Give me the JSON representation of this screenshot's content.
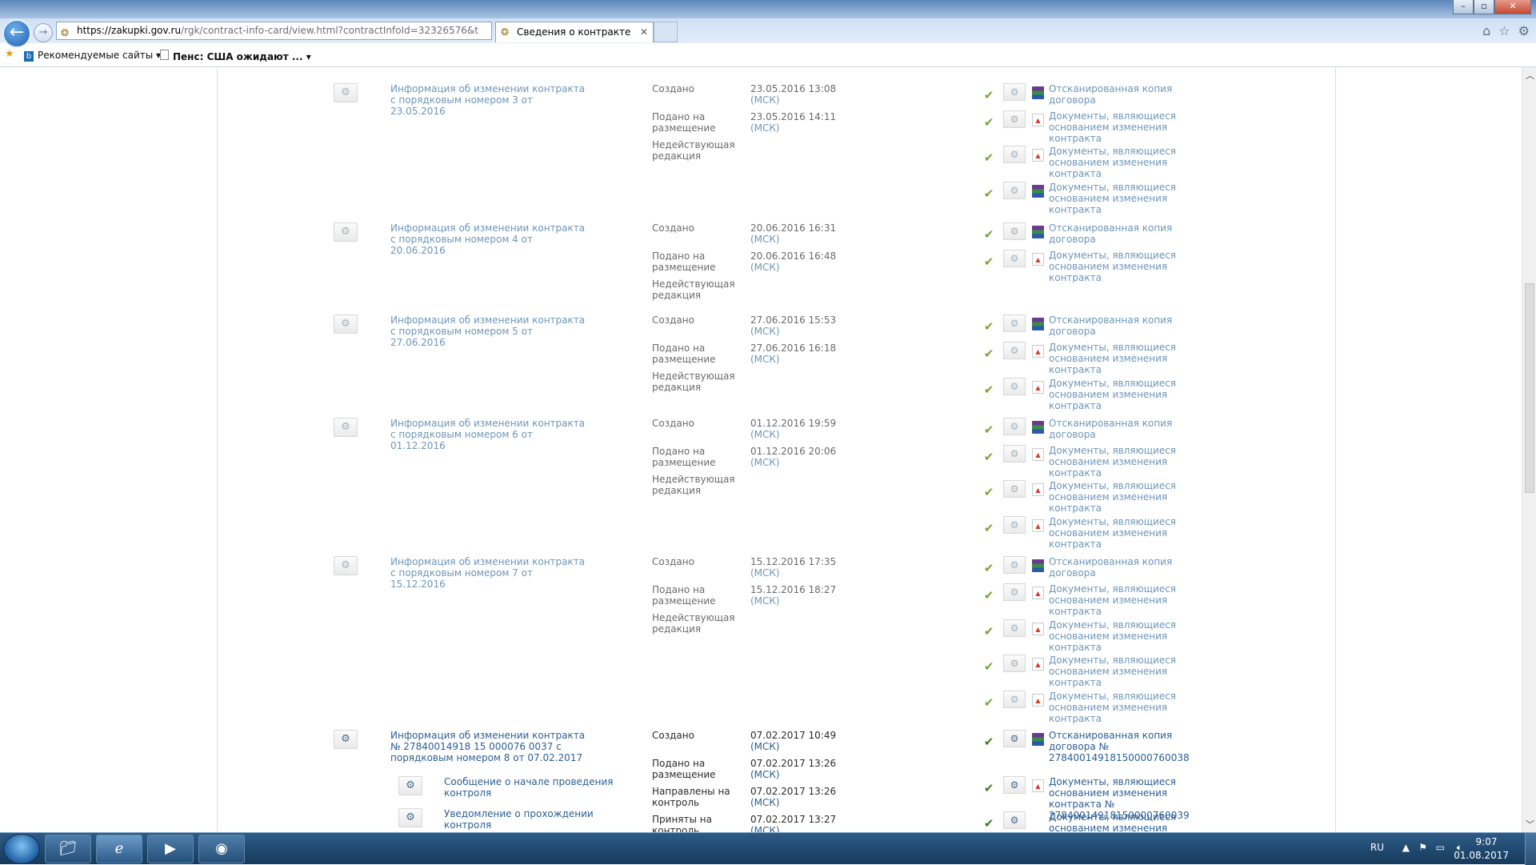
{
  "browser": {
    "url_host": "https://zakupki.gov.ru",
    "url_path": "/rgk/contract-info-card/view.html?contractInfoId=32326576&t",
    "tab_title": "Сведения о контракте",
    "favorites": [
      {
        "label": "Рекомендуемые сайты",
        "icon": "bing-icon"
      },
      {
        "label": "Пенс: США ожидают ...",
        "icon": "page-icon"
      }
    ]
  },
  "rows": [
    {
      "title": "Информация об изменении контракта с порядковым номером 3 от 23.05.2016",
      "events": [
        {
          "label": "Создано",
          "date": "23.05.2016 13:08",
          "tz": "(МСК)"
        },
        {
          "label": "Подано на размещение",
          "date": "23.05.2016 14:11",
          "tz": "(МСК)"
        },
        {
          "label": "Недействующая редакция",
          "date": "",
          "tz": ""
        }
      ],
      "docs": [
        {
          "type": "rar",
          "text": "Отсканированная копия договора"
        },
        {
          "type": "pdf",
          "text": "Документы, являющиеся основанием изменения контракта"
        },
        {
          "type": "pdf",
          "text": "Документы, являющиеся основанием изменения контракта"
        },
        {
          "type": "rar",
          "text": "Документы, являющиеся основанием изменения контракта"
        }
      ]
    },
    {
      "title": "Информация об изменении контракта с порядковым номером 4 от 20.06.2016",
      "events": [
        {
          "label": "Создано",
          "date": "20.06.2016 16:31",
          "tz": "(МСК)"
        },
        {
          "label": "Подано на размещение",
          "date": "20.06.2016 16:48",
          "tz": "(МСК)"
        },
        {
          "label": "Недействующая редакция",
          "date": "",
          "tz": ""
        }
      ],
      "docs": [
        {
          "type": "rar",
          "text": "Отсканированная копия договора"
        },
        {
          "type": "pdf",
          "text": "Документы, являющиеся основанием изменения контракта"
        }
      ]
    },
    {
      "title": "Информация об изменении контракта с порядковым номером 5 от 27.06.2016",
      "events": [
        {
          "label": "Создано",
          "date": "27.06.2016 15:53",
          "tz": "(МСК)"
        },
        {
          "label": "Подано на размещение",
          "date": "27.06.2016 16:18",
          "tz": "(МСК)"
        },
        {
          "label": "Недействующая редакция",
          "date": "",
          "tz": ""
        }
      ],
      "docs": [
        {
          "type": "rar",
          "text": "Отсканированная копия договора"
        },
        {
          "type": "pdf",
          "text": "Документы, являющиеся основанием изменения контракта"
        },
        {
          "type": "pdf",
          "text": "Документы, являющиеся основанием изменения контракта"
        }
      ]
    },
    {
      "title": "Информация об изменении контракта с порядковым номером 6 от 01.12.2016",
      "events": [
        {
          "label": "Создано",
          "date": "01.12.2016 19:59",
          "tz": "(МСК)"
        },
        {
          "label": "Подано на размещение",
          "date": "01.12.2016 20:06",
          "tz": "(МСК)"
        },
        {
          "label": "Недействующая редакция",
          "date": "",
          "tz": ""
        }
      ],
      "docs": [
        {
          "type": "rar",
          "text": "Отсканированная копия договора"
        },
        {
          "type": "pdf",
          "text": "Документы, являющиеся основанием изменения контракта"
        },
        {
          "type": "pdf",
          "text": "Документы, являющиеся основанием изменения контракта"
        },
        {
          "type": "pdf",
          "text": "Документы, являющиеся основанием изменения контракта"
        }
      ]
    },
    {
      "title": "Информация об изменении контракта с порядковым номером 7 от 15.12.2016",
      "events": [
        {
          "label": "Создано",
          "date": "15.12.2016 17:35",
          "tz": "(МСК)"
        },
        {
          "label": "Подано на размещение",
          "date": "15.12.2016 18:27",
          "tz": "(МСК)"
        },
        {
          "label": "Недействующая редакция",
          "date": "",
          "tz": ""
        }
      ],
      "docs": [
        {
          "type": "rar",
          "text": "Отсканированная копия договора"
        },
        {
          "type": "pdf",
          "text": "Документы, являющиеся основанием изменения контракта"
        },
        {
          "type": "pdf",
          "text": "Документы, являющиеся основанием изменения контракта"
        },
        {
          "type": "pdf",
          "text": "Документы, являющиеся основанием изменения контракта"
        },
        {
          "type": "pdf",
          "text": "Документы, являющиеся основанием изменения контракта"
        }
      ]
    }
  ],
  "current": {
    "title": "Информация об изменении контракта № 27840014918 15 000076 0037 с порядковым номером 8 от 07.02.2017",
    "subs": [
      "Сообщение о начале проведения контроля",
      "Уведомление о прохождении контроля"
    ],
    "events": [
      {
        "label": "Создано",
        "date": "07.02.2017 10:49",
        "tz": "(МСК)"
      },
      {
        "label": "Подано на размещение",
        "date": "07.02.2017 13:26",
        "tz": "(МСК)"
      },
      {
        "label": "Направлены на контроль",
        "date": "07.02.2017 13:26",
        "tz": "(МСК)"
      },
      {
        "label": "Приняты на контроль",
        "date": "07.02.2017 13:27",
        "tz": "(МСК)"
      }
    ],
    "docs": [
      {
        "type": "rar",
        "text": "Отсканированная копия договора № 27840014918150000760038"
      },
      {
        "type": "pdf",
        "text": "Документы, являющиеся основанием изменения контракта № 27840014918150000760039"
      },
      {
        "type": "none",
        "text": "Документы, являющиеся основанием изменения"
      }
    ]
  },
  "taskbar": {
    "lang": "RU",
    "time": "9:07",
    "date": "01.08.2017"
  }
}
